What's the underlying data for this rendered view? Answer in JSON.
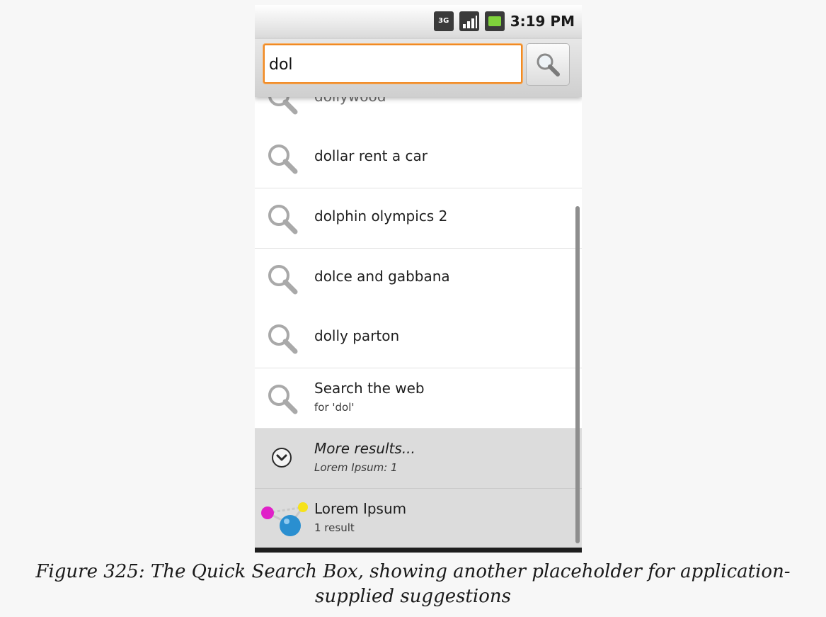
{
  "status_bar": {
    "network_label": "3G",
    "time": "3:19 PM",
    "icons": [
      "3g-data-icon",
      "signal-strength-icon",
      "battery-charging-icon"
    ]
  },
  "search": {
    "query": "dol",
    "button_icon": "magnifier-icon",
    "accent_color": "#f08a24"
  },
  "suggestions": [
    {
      "icon": "magnifier-icon",
      "text": "dollywood"
    },
    {
      "icon": "magnifier-icon",
      "text": "dollar rent a car"
    },
    {
      "icon": "magnifier-icon",
      "text": "dolphin olympics 2"
    },
    {
      "icon": "magnifier-icon",
      "text": "dolce and gabbana"
    },
    {
      "icon": "magnifier-icon",
      "text": "dolly parton"
    },
    {
      "icon": "magnifier-icon",
      "text": "Search the web",
      "subtext": "for 'dol'"
    }
  ],
  "more_results": {
    "icon": "expand-chevron-icon",
    "title": "More results...",
    "subtitle": "Lorem Ipsum: 1"
  },
  "app_result": {
    "icon": "molecule-app-icon",
    "title": "Lorem Ipsum",
    "subtitle": "1 result"
  },
  "caption": {
    "line1": "Figure 325: The Quick Search Box, showing another placeholder for application-",
    "line2": "supplied suggestions"
  }
}
